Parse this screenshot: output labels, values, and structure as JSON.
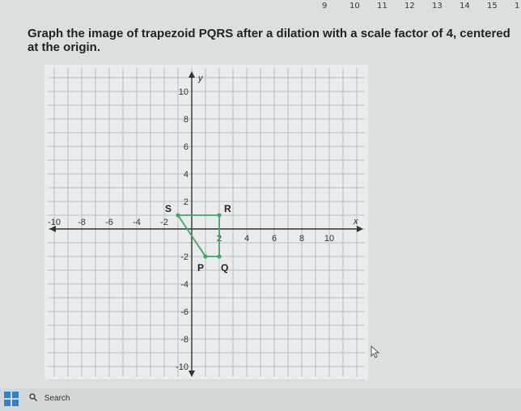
{
  "ruler": {
    "labels": [
      "9",
      "10",
      "11",
      "12",
      "13",
      "14",
      "15",
      "1"
    ]
  },
  "question": {
    "text": "Graph the image of trapezoid PQRS after a dilation with a scale factor of 4, centered at the origin."
  },
  "graph": {
    "x_axis_label": "x",
    "y_axis_label": "y",
    "x_tick_labels": [
      "-10",
      "-8",
      "-6",
      "-4",
      "-2",
      "2",
      "4",
      "6",
      "8",
      "10"
    ],
    "y_tick_labels": [
      "10",
      "8",
      "6",
      "4",
      "2",
      "-2",
      "-4",
      "-6",
      "-8",
      "-10"
    ],
    "range": {
      "x": [
        -10,
        10
      ],
      "y": [
        -10,
        10
      ]
    },
    "points": [
      {
        "name": "P",
        "x": 1,
        "y": -2
      },
      {
        "name": "Q",
        "x": 2,
        "y": -2
      },
      {
        "name": "R",
        "x": 2,
        "y": 1
      },
      {
        "name": "S",
        "x": -1,
        "y": 1
      }
    ],
    "colors": {
      "shape": "#3ba86a",
      "grid": "#bcbfc4",
      "axis": "#333333",
      "paper": "#e9ebec"
    }
  },
  "taskbar": {
    "search_label": "Search"
  }
}
